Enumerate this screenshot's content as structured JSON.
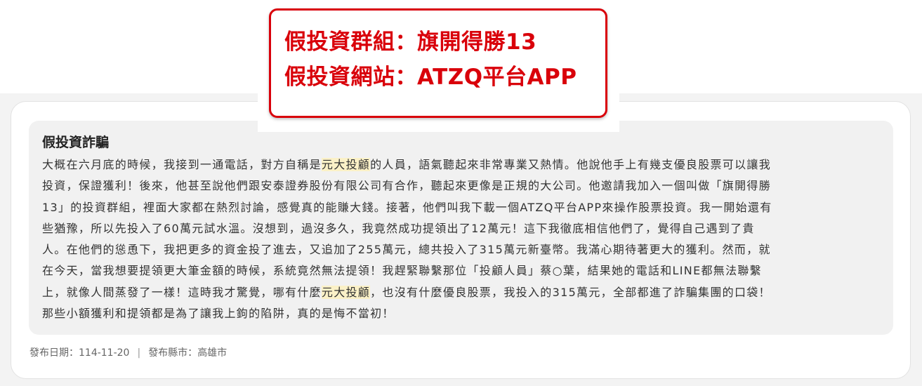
{
  "callout": {
    "group_line": "假投資群組：旗開得勝13",
    "site_line": "假投資網站：ATZQ平台APP"
  },
  "story": {
    "title": "假投資詐騙",
    "lines": [
      [
        "大概在六月底的時候，我接到一通電話，對方自稱是",
        "元大投顧",
        "的人員，語氣聽起來非常專業又熱情。他說他手上有幾支優良股票可以讓我"
      ],
      [
        "投資，保證獲利！後來，他甚至說他們跟安泰證券股份有限公司有合作，聽起來更像是正規的大公司。他邀請我加入一個叫做「旗開得勝",
        "",
        ""
      ],
      [
        "13」的投資群組，裡面大家都在熱烈討論，感覺真的能賺大錢。接著，他們叫我下載一個ATZQ平台APP來操作股票投資。我一開始還有",
        "",
        ""
      ],
      [
        "些猶豫，所以先投入了60萬元試水溫。沒想到，過沒多久，我竟然成功提領出了12萬元！這下我徹底相信他們了，覺得自己遇到了貴",
        "",
        ""
      ],
      [
        "人。在他們的慫恿下，我把更多的資金投了進去，又追加了255萬元，總共投入了315萬元新臺幣。我滿心期待著更大的獲利。然而，就",
        "",
        ""
      ],
      [
        "在今天，當我想要提領更大筆金額的時候，系統竟然無法提領！我趕緊聯繫那位「投顧人員」蔡○葉，結果她的電話和LINE都無法聯繫",
        "",
        ""
      ],
      [
        "上，就像人間蒸發了一樣！這時我才驚覺，哪有什麼",
        "元大投顧",
        "，也沒有什麼優良股票，我投入的315萬元，全部都進了詐騙集團的口袋！"
      ],
      [
        "那些小額獲利和提領都是為了讓我上鉤的陷阱，真的是悔不當初！",
        "",
        ""
      ]
    ]
  },
  "meta": {
    "date_label": "發布日期：",
    "date_value": "114-11-20",
    "separator": "|",
    "county_label": "發布縣市：",
    "county_value": "高雄市"
  },
  "colors": {
    "alert_red": "#d9000a",
    "highlight": "#fbf1c7",
    "story_bg": "#f1f1f1",
    "page_bg": "#f3f3f3"
  }
}
